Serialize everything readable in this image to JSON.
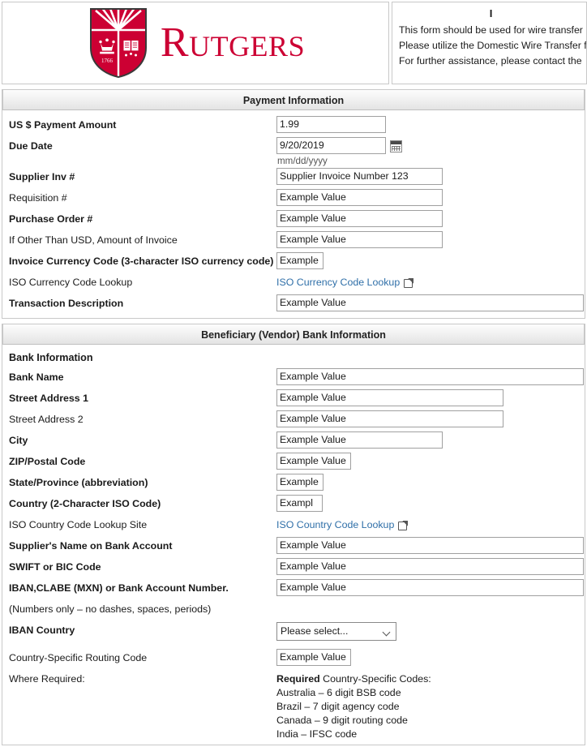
{
  "header": {
    "logo_alt": "Rutgers University shield",
    "wordmark": "Rutgers",
    "shield_year": "1766",
    "brand_color": "#cc0033",
    "instructions_title": "I",
    "instructions_lines": [
      "This form should be used for wire transfer",
      "Please utilize the Domestic Wire Transfer f",
      "For further assistance, please contact the"
    ]
  },
  "payment_section": {
    "title": "Payment Information",
    "fields": {
      "amount_label": "US $ Payment Amount",
      "amount_value": "1.99",
      "due_date_label": "Due Date",
      "due_date_value": "9/20/2019",
      "due_date_hint": "mm/dd/yyyy",
      "supplier_inv_label": "Supplier Inv #",
      "supplier_inv_value": "Supplier Invoice Number 123",
      "requisition_label": "Requisition #",
      "requisition_value": "Example Value",
      "purchase_order_label": "Purchase Order #",
      "purchase_order_value": "Example Value",
      "other_usd_label": "If Other Than USD, Amount of Invoice",
      "other_usd_value": "Example Value",
      "currency_code_label": "Invoice Currency Code (3-character ISO currency code)",
      "currency_code_value": "Example",
      "currency_lookup_label": "ISO Currency Code Lookup",
      "currency_lookup_link": "ISO Currency Code Lookup",
      "transaction_desc_label": "Transaction Description",
      "transaction_desc_value": "Example Value"
    }
  },
  "bank_section": {
    "title": "Beneficiary (Vendor) Bank Information",
    "subheading": "Bank Information",
    "fields": {
      "bank_name_label": "Bank Name",
      "bank_name_value": "Example Value",
      "street1_label": "Street Address 1",
      "street1_value": "Example Value",
      "street2_label": "Street Address 2",
      "street2_value": "Example Value",
      "city_label": "City",
      "city_value": "Example Value",
      "zip_label": "ZIP/Postal Code",
      "zip_value": "Example Value",
      "state_label": "State/Province (abbreviation)",
      "state_value": "Example",
      "country_label": "Country (2-Character ISO Code)",
      "country_value": "Exampl",
      "country_lookup_label": "ISO Country Code Lookup Site",
      "country_lookup_link": "ISO Country Code Lookup",
      "supplier_name_label": "Supplier's Name on Bank Account",
      "supplier_name_value": "Example Value",
      "swift_label": "SWIFT or BIC Code",
      "swift_value": "Example Value",
      "iban_label": "IBAN,CLABE (MXN) or Bank Account Number.",
      "iban_value": "Example Value",
      "iban_note": "(Numbers only – no dashes, spaces, periods)",
      "iban_country_label": "IBAN Country",
      "iban_country_value": "Please select...",
      "routing_label": "Country-Specific Routing Code",
      "routing_value": "Example Value",
      "where_required_label": "Where Required:",
      "codes_title_bold": "Required",
      "codes_title_rest": " Country-Specific Codes:",
      "codes_lines": [
        "Australia – 6 digit BSB code",
        "Brazil – 7 digit agency code",
        "Canada – 9 digit routing code",
        "India – IFSC code"
      ]
    }
  }
}
